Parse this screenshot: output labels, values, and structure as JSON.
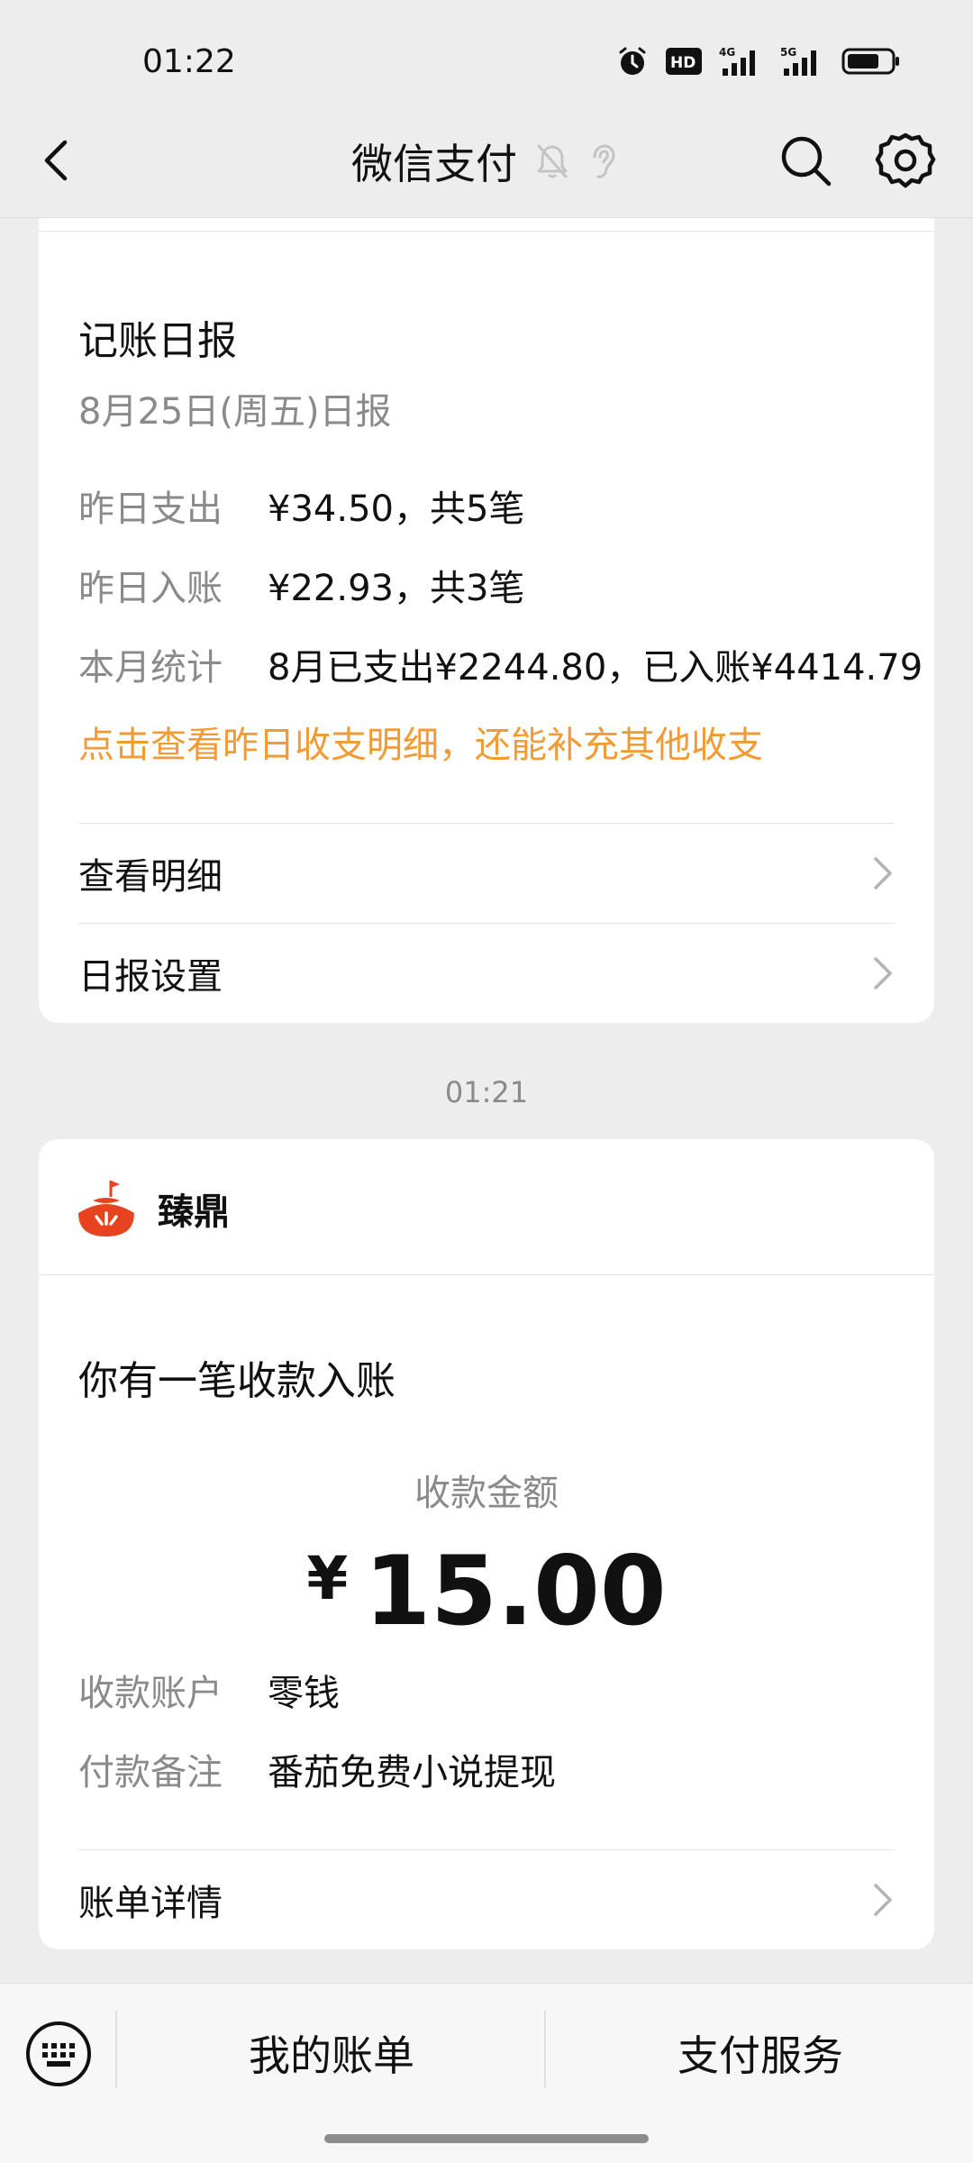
{
  "status_bar": {
    "time": "01:22",
    "icons": [
      "alarm-icon",
      "hd-icon",
      "4g-signal-icon",
      "5g-signal-icon",
      "battery-icon"
    ]
  },
  "nav": {
    "title": "微信支付",
    "icons": [
      "back-icon",
      "mute-bell-icon",
      "ear-icon",
      "search-icon",
      "gear-icon"
    ]
  },
  "daily_report": {
    "heading": "记账日报",
    "subheading": "8月25日(周五)日报",
    "rows": [
      {
        "label": "昨日支出",
        "value": "¥34.50，共5笔"
      },
      {
        "label": "昨日入账",
        "value": "¥22.93，共3笔"
      },
      {
        "label": "本月统计",
        "value": "8月已支出¥2244.80，已入账¥4414.79"
      }
    ],
    "prompt": "点击查看昨日收支明细，还能补充其他收支",
    "menu": [
      {
        "label": "查看明细"
      },
      {
        "label": "日报设置"
      }
    ]
  },
  "timestamp": "01:21",
  "payment_notice": {
    "merchant": "臻鼎",
    "heading": "你有一笔收款入账",
    "amount_label": "收款金额",
    "currency": "¥",
    "amount": "15.00",
    "rows": [
      {
        "label": "收款账户",
        "value": "零钱"
      },
      {
        "label": "付款备注",
        "value": "番茄免费小说提现"
      }
    ],
    "detail_link": "账单详情"
  },
  "bottom_bar": {
    "items": [
      "我的账单",
      "支付服务"
    ]
  },
  "colors": {
    "background": "#ededed",
    "card": "#ffffff",
    "accent_orange": "#f29a33",
    "muted_text": "#8a8a8a",
    "merchant_logo": "#e8431f"
  }
}
